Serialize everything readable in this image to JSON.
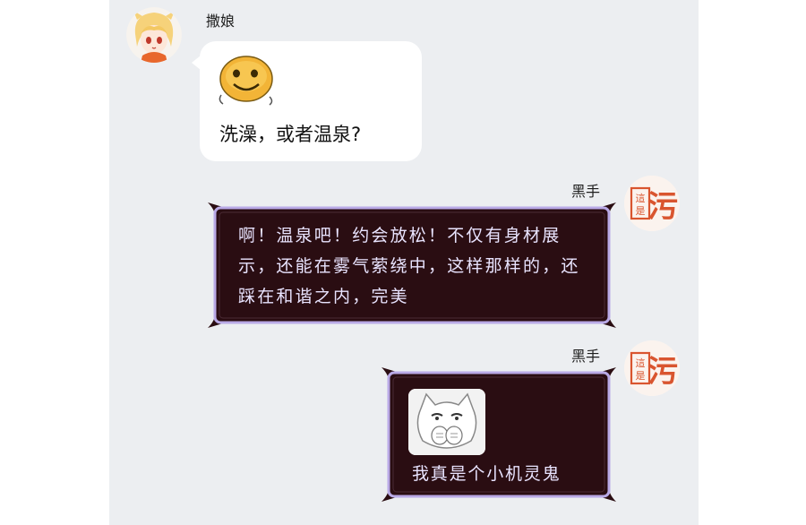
{
  "messages": [
    {
      "sender": "撒娘",
      "side": "left",
      "text": "洗澡，或者温泉?",
      "sticker": "smiley-face-icon"
    },
    {
      "sender": "黑手",
      "side": "right",
      "text": "啊！温泉吧！约会放松！不仅有身材展示，还能在雾气萦绕中，这样那样的，还踩在和谐之内，完美"
    },
    {
      "sender": "黑手",
      "side": "right",
      "text": "我真是个小机灵鬼",
      "sticker": "cat-meme-icon"
    }
  ],
  "avatars": {
    "left": "anime-girl-avatar-icon",
    "right": "seal-stamp-avatar-icon",
    "right_seal_text": "這是污"
  },
  "colors": {
    "chat_bg": "#eceef1",
    "bubble_white": "#ffffff",
    "bubble_dark": "#2a0d12",
    "bubble_border": "#b9a9e6",
    "dark_text": "#e9e4ff",
    "seal_red": "#d9552f"
  }
}
